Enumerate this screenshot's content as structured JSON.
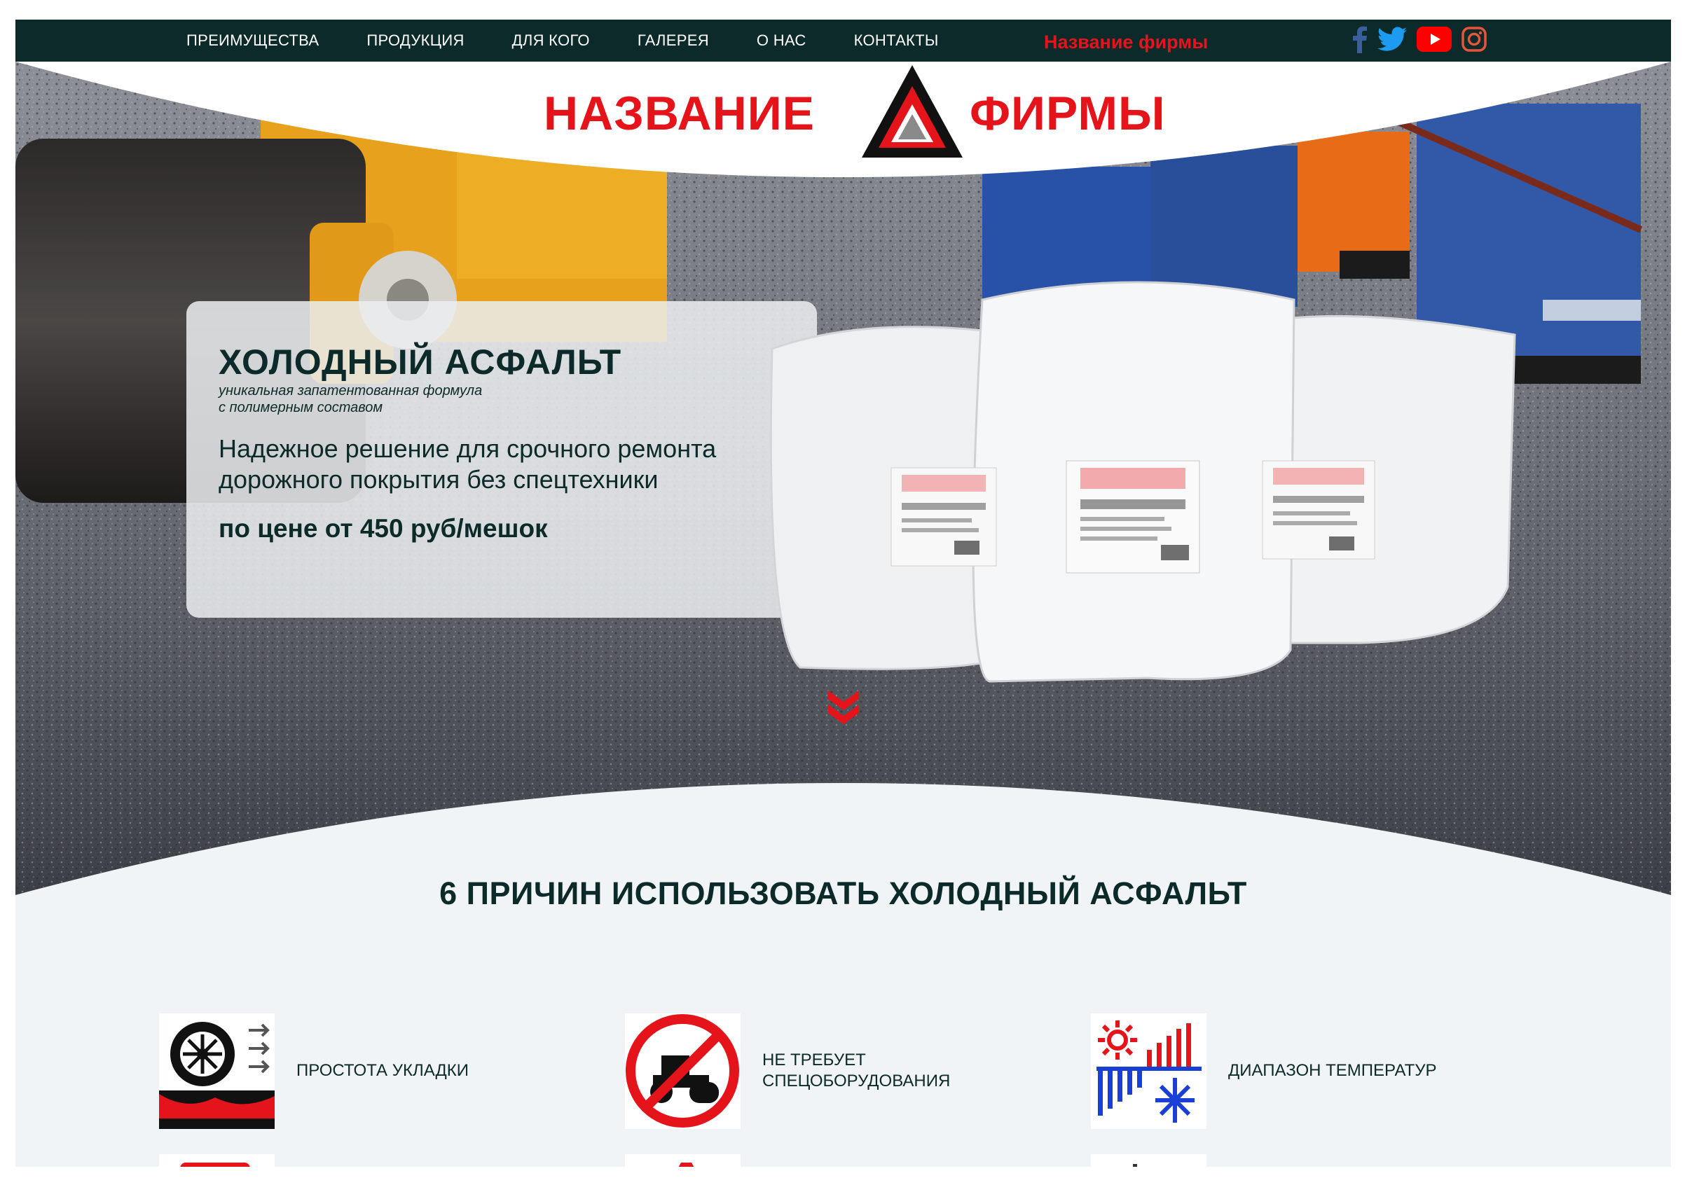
{
  "nav": {
    "items": [
      {
        "label": "ПРЕИМУЩЕСТВА"
      },
      {
        "label": "ПРОДУКЦИЯ"
      },
      {
        "label": "ДЛЯ КОГО"
      },
      {
        "label": "ГАЛЕРЕЯ"
      },
      {
        "label": "О НАС"
      },
      {
        "label": "КОНТАКТЫ"
      }
    ],
    "brand": "Название фирмы",
    "social": [
      "facebook-icon",
      "twitter-icon",
      "youtube-icon",
      "instagram-icon"
    ]
  },
  "logo": {
    "left": "НАЗВАНИЕ",
    "right": "ФИРМЫ"
  },
  "hero": {
    "title": "ХОЛОДНЫЙ АСФАЛЬТ",
    "subtitle_line1": "уникальная запатентованная формула",
    "subtitle_line2": "с полимерным составом",
    "desc_line1": "Надежное решение для срочного ремонта",
    "desc_line2": "дорожного покрытия без спецтехники",
    "price": "по цене от 450 руб/мешок"
  },
  "reasons": {
    "title": "6 ПРИЧИН ИСПОЛЬЗОВАТЬ ХОЛОДНЫЙ АСФАЛЬТ",
    "items": [
      {
        "label": "ПРОСТОТА УКЛАДКИ",
        "icon": "wheel-rolling-icon"
      },
      {
        "label_line1": "НЕ ТРЕБУЕТ",
        "label_line2": "СПЕЦОБОРУДОВАНИЯ",
        "icon": "no-roller-icon"
      },
      {
        "label": "ДИАПАЗОН ТЕМПЕРАТУР",
        "icon": "temperature-range-icon"
      }
    ]
  },
  "colors": {
    "nav_bg": "#0d2a2a",
    "brand_red": "#e5141a",
    "text_dark": "#0d2a2a",
    "section_bg": "#f1f4f6"
  }
}
